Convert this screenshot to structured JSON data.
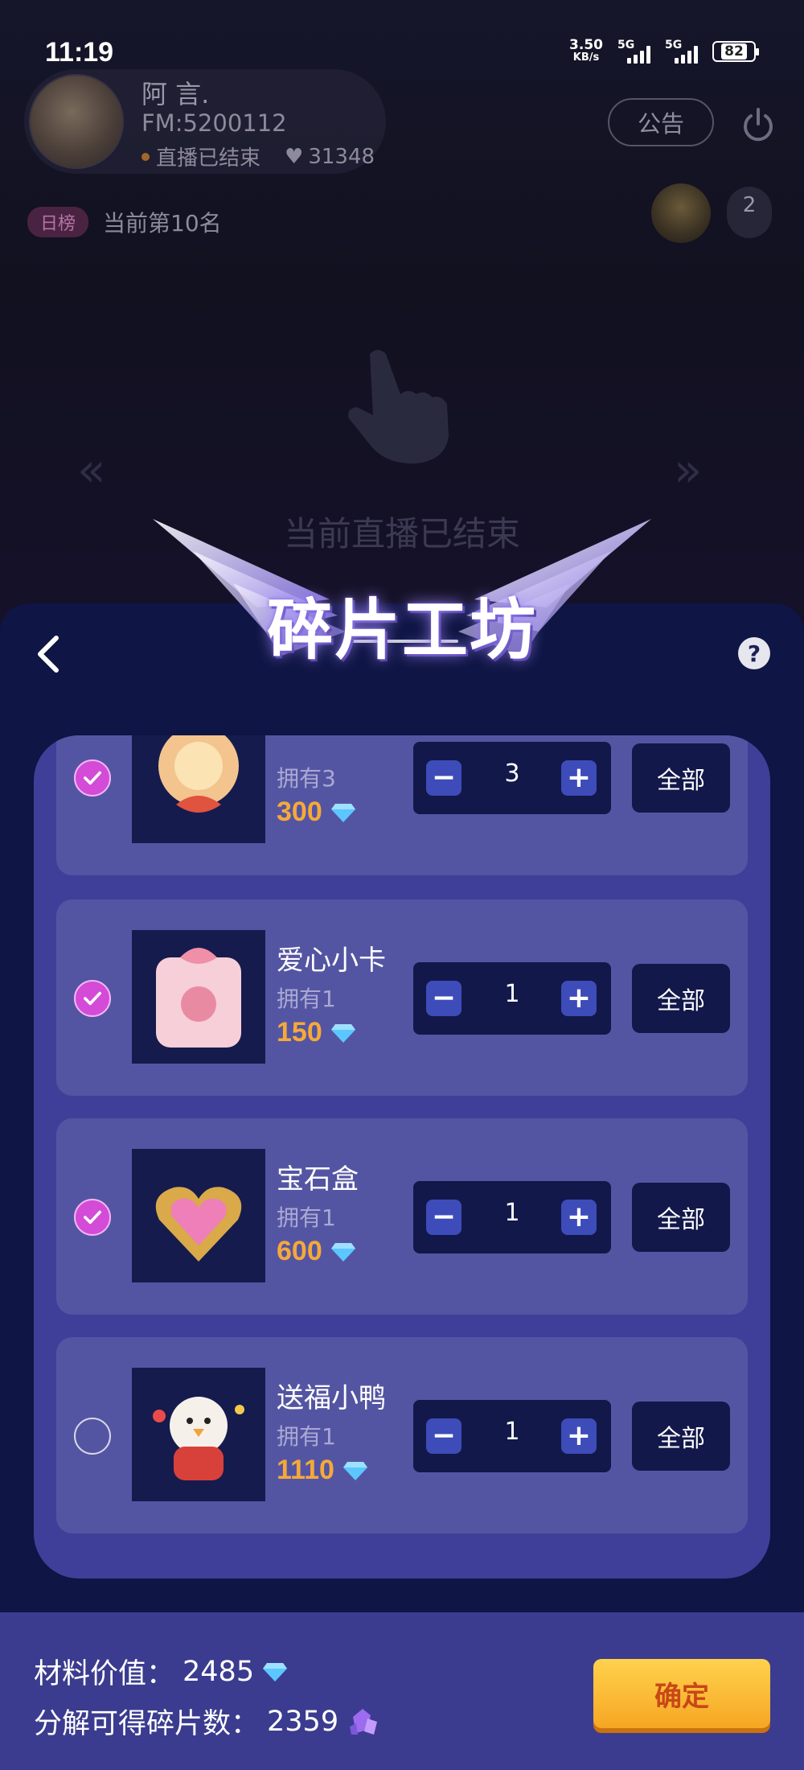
{
  "status_bar": {
    "time": "11:19",
    "net_speed_value": "3.50",
    "net_speed_unit": "KB/s",
    "sim1": "5G",
    "sim2": "5G",
    "battery": "82"
  },
  "host": {
    "name": "阿 言.",
    "fm_id": "FM:5200112",
    "live_status": "直播已结束",
    "likes": "31348"
  },
  "notice_label": "公告",
  "rank": {
    "tag": "日榜",
    "text": "当前第10名"
  },
  "viewers": {
    "count": "2"
  },
  "stage": {
    "ended_text": "当前直播已结束"
  },
  "sheet": {
    "title": "碎片工坊",
    "help_label": "?",
    "all_label": "全部",
    "minus_label": "−",
    "plus_label": "+",
    "items": [
      {
        "name": "",
        "owned": "拥有3",
        "price": "300",
        "qty": "3",
        "checked": true
      },
      {
        "name": "爱心小卡",
        "owned": "拥有1",
        "price": "150",
        "qty": "1",
        "checked": true
      },
      {
        "name": "宝石盒",
        "owned": "拥有1",
        "price": "600",
        "qty": "1",
        "checked": true
      },
      {
        "name": "送福小鸭",
        "owned": "拥有1",
        "price": "1110",
        "qty": "1",
        "checked": false
      }
    ]
  },
  "footer": {
    "material_label": "材料价值：",
    "material_value": "2485",
    "fragments_label": "分解可得碎片数：",
    "fragments_value": "2359",
    "confirm_label": "确定"
  },
  "colors": {
    "sheet_bg": "#0f1544",
    "panel_bg": "#3f3f9a",
    "row_bg": "#5455a2",
    "price": "#f5a93a",
    "check_on": "#d44bd7",
    "confirm": "#f6a623"
  }
}
